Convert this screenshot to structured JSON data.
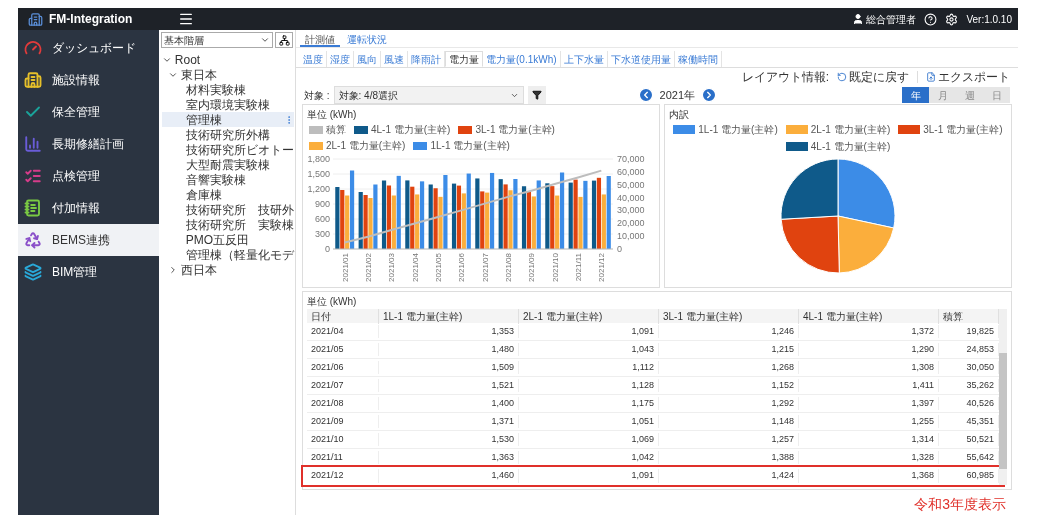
{
  "top_bar": {
    "logo": "FM-Integration",
    "user": "総合管理者",
    "version": "Ver:1.0.10"
  },
  "sidebar": {
    "items": [
      {
        "label": "ダッシュボード",
        "selected": false
      },
      {
        "label": "施設情報",
        "selected": false
      },
      {
        "label": "保全管理",
        "selected": false
      },
      {
        "label": "長期修繕計画",
        "selected": false
      },
      {
        "label": "点検管理",
        "selected": false
      },
      {
        "label": "付加情報",
        "selected": false
      },
      {
        "label": "BEMS連携",
        "selected": true
      },
      {
        "label": "BIM管理",
        "selected": false
      }
    ]
  },
  "tree": {
    "hierarchy": "基本階層",
    "nodes": [
      {
        "label": "Root",
        "expanded": true,
        "selected": false,
        "children": [
          {
            "label": "東日本",
            "expanded": true,
            "selected": false,
            "children": [
              {
                "label": "材料実験棟",
                "selected": false
              },
              {
                "label": "室内環境実験棟",
                "selected": false
              },
              {
                "label": "管理棟",
                "selected": true
              },
              {
                "label": "技術研究所外構",
                "selected": false
              },
              {
                "label": "技術研究所ビオトー",
                "selected": false
              },
              {
                "label": "大型耐震実験棟",
                "selected": false
              },
              {
                "label": "音響実験棟",
                "selected": false
              },
              {
                "label": "倉庫棟",
                "selected": false
              },
              {
                "label": "技術研究所　技研外",
                "selected": false
              },
              {
                "label": "技術研究所　実験棟",
                "selected": false
              },
              {
                "label": "PMO五反田",
                "selected": false
              },
              {
                "label": "管理棟（軽量化モデ",
                "selected": false
              }
            ]
          },
          {
            "label": "西日本",
            "expanded": false,
            "selected": false
          }
        ]
      }
    ]
  },
  "view_tabs": [
    {
      "label": "計測値",
      "selected": true
    },
    {
      "label": "運転状況",
      "selected": false
    }
  ],
  "measure_tabs": [
    {
      "label": "温度",
      "selected": false
    },
    {
      "label": "湿度",
      "selected": false
    },
    {
      "label": "風向",
      "selected": false
    },
    {
      "label": "風速",
      "selected": false
    },
    {
      "label": "降雨計",
      "selected": false
    },
    {
      "label": "電力量",
      "selected": true
    },
    {
      "label": "電力量(0.1kWh)",
      "selected": false
    },
    {
      "label": "上下水量",
      "selected": false
    },
    {
      "label": "下水道使用量",
      "selected": false
    },
    {
      "label": "稼働時間",
      "selected": false
    }
  ],
  "layout_info": {
    "label": "レイアウト情報:",
    "reset": "既定に戻す",
    "export": "エクスポート"
  },
  "target": {
    "label": "対象 :",
    "value": "対象: 4/8選択"
  },
  "year": "2021年",
  "periods": [
    {
      "label": "年",
      "selected": true
    },
    {
      "label": "月",
      "selected": false
    },
    {
      "label": "週",
      "selected": false
    },
    {
      "label": "日",
      "selected": false
    }
  ],
  "bar_panel": {
    "title": "単位 (kWh)",
    "cumulative_line": {
      "name": "積算",
      "color": "#bdbdbd"
    },
    "right_axis": [
      "70,000",
      "60,000",
      "50,000",
      "40,000",
      "30,000",
      "20,000",
      "10,000",
      "0"
    ],
    "chart_data": {
      "type": "bar",
      "stacked": false,
      "grid": true,
      "categories": [
        "2021/01",
        "2021/02",
        "2021/03",
        "2021/04",
        "2021/05",
        "2021/06",
        "2021/07",
        "2021/08",
        "2021/09",
        "2021/10",
        "2021/11",
        "2021/12"
      ],
      "ylim": [
        0,
        1800
      ],
      "yticks": [
        0,
        300,
        600,
        900,
        {
          "value": 1200,
          "label": "1,200"
        },
        {
          "value": 1500,
          "label": "1,500"
        },
        {
          "value": 1800,
          "label": "1,800"
        }
      ],
      "series": [
        {
          "name": "4L-1 電力量(主幹)",
          "color": "#0f5a8a",
          "values": [
            1240,
            1140,
            1370,
            1372,
            1290,
            1308,
            1411,
            1397,
            1255,
            1314,
            1328,
            1368
          ]
        },
        {
          "name": "3L-1 電力量(主幹)",
          "color": "#e0430f",
          "values": [
            1180,
            1080,
            1270,
            1246,
            1215,
            1268,
            1152,
            1292,
            1148,
            1257,
            1388,
            1424
          ]
        },
        {
          "name": "2L-1 電力量(主幹)",
          "color": "#fbae3c",
          "values": [
            1070,
            1020,
            1070,
            1091,
            1043,
            1112,
            1128,
            1175,
            1051,
            1069,
            1042,
            1091
          ]
        },
        {
          "name": "1L-1 電力量(主幹)",
          "color": "#3c8ce7",
          "values": [
            1570,
            1290,
            1463,
            1353,
            1480,
            1509,
            1521,
            1400,
            1371,
            1530,
            1363,
            1460
          ]
        }
      ]
    }
  },
  "pie_panel": {
    "title": "内訳",
    "chart_data": {
      "type": "pie",
      "legend": "top",
      "categories": [
        "1L-1 電力量(主幹)",
        "2L-1 電力量(主幹)",
        "3L-1 電力量(主幹)",
        "4L-1 電力量(主幹)"
      ],
      "colors": [
        "#3c8ce7",
        "#fbae3c",
        "#e0430f",
        "#0f5a8a"
      ],
      "values": [
        28.38,
        21.25,
        24.46,
        25.91
      ]
    }
  },
  "table": {
    "title": "単位 (kWh)",
    "columns": [
      "日付",
      "1L-1 電力量(主幹)",
      "2L-1 電力量(主幹)",
      "3L-1 電力量(主幹)",
      "4L-1 電力量(主幹)",
      "積算"
    ],
    "rows": [
      {
        "cells": [
          "2021/04",
          "1,353",
          "1,091",
          "1,246",
          "1,372",
          "19,825"
        ],
        "boxed": false
      },
      {
        "cells": [
          "2021/05",
          "1,480",
          "1,043",
          "1,215",
          "1,290",
          "24,853"
        ],
        "boxed": false
      },
      {
        "cells": [
          "2021/06",
          "1,509",
          "1,112",
          "1,268",
          "1,308",
          "30,050"
        ],
        "boxed": false
      },
      {
        "cells": [
          "2021/07",
          "1,521",
          "1,128",
          "1,152",
          "1,411",
          "35,262"
        ],
        "boxed": false
      },
      {
        "cells": [
          "2021/08",
          "1,400",
          "1,175",
          "1,292",
          "1,397",
          "40,526"
        ],
        "boxed": false
      },
      {
        "cells": [
          "2021/09",
          "1,371",
          "1,051",
          "1,148",
          "1,255",
          "45,351"
        ],
        "boxed": false
      },
      {
        "cells": [
          "2021/10",
          "1,530",
          "1,069",
          "1,257",
          "1,314",
          "50,521"
        ],
        "boxed": false
      },
      {
        "cells": [
          "2021/11",
          "1,363",
          "1,042",
          "1,388",
          "1,328",
          "55,642"
        ],
        "boxed": false
      },
      {
        "cells": [
          "2021/12",
          "1,460",
          "1,091",
          "1,424",
          "1,368",
          "60,985"
        ],
        "boxed": true
      }
    ]
  },
  "annotation": "令和3年度表示"
}
